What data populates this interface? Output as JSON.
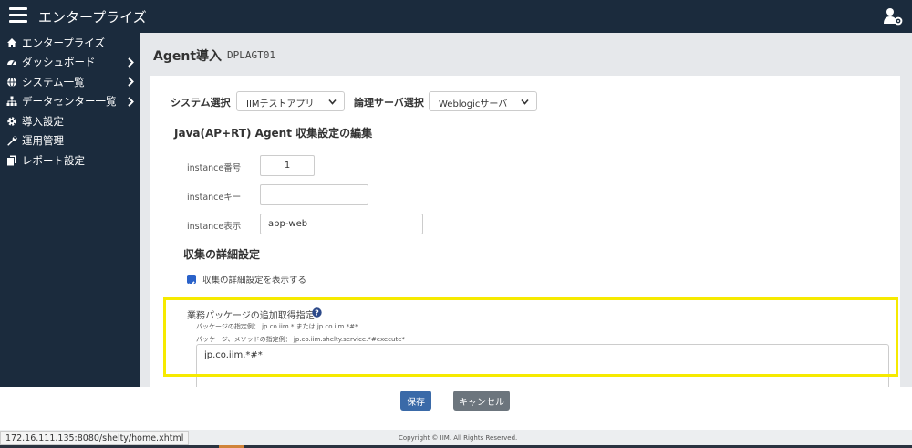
{
  "header": {
    "title": "エンタープライズ"
  },
  "sidebar": {
    "items": [
      {
        "label": "エンタープライズ",
        "icon": "home-icon",
        "has_children": false
      },
      {
        "label": "ダッシュボード",
        "icon": "dashboard-icon",
        "has_children": true
      },
      {
        "label": "システム一覧",
        "icon": "globe-icon",
        "has_children": true
      },
      {
        "label": "データセンター一覧",
        "icon": "sitemap-icon",
        "has_children": true
      },
      {
        "label": "導入設定",
        "icon": "gear-icon",
        "has_children": false
      },
      {
        "label": "運用管理",
        "icon": "wrench-icon",
        "has_children": false
      },
      {
        "label": "レポート設定",
        "icon": "copy-icon",
        "has_children": false
      }
    ]
  },
  "page": {
    "title": "Agent導入",
    "code": "DPLAGT01"
  },
  "system_select": {
    "label": "システム選択",
    "value": "IIMテストアプリ"
  },
  "server_select": {
    "label": "論理サーバ選択",
    "value": "Weblogicサーバ"
  },
  "edit_section": {
    "title": "Java(AP+RT) Agent 収集設定の編集"
  },
  "fields": {
    "instance_number": {
      "label": "instance番号",
      "value": "1"
    },
    "instance_key": {
      "label": "instanceキー",
      "value": ""
    },
    "instance_display": {
      "label": "instance表示",
      "value": "app-web"
    }
  },
  "detail_section": {
    "title": "収集の詳細設定",
    "show_detail_checkbox": {
      "label": "収集の詳細設定を表示する",
      "checked": true
    }
  },
  "package": {
    "title": "業務パッケージの追加取得指定",
    "hint1": "パッケージの指定例： jp.co.iim.* または jp.co.iim.*#*",
    "hint2": "パッケージ、メソッドの指定例： jp.co.iim.shelty.service.*#execute*",
    "value": "jp.co.iim.*#*"
  },
  "buttons": {
    "save": "保存",
    "cancel": "キャンセル"
  },
  "status": {
    "url": "172.16.111.135:8080/shelty/home.xhtml"
  },
  "footer": {
    "copyright": "Copyright © IIM. All Rights Reserved."
  },
  "colors": {
    "header_bg": "#1b2b3d",
    "save_button": "#3a6aa8",
    "cancel_button": "#6c757d",
    "highlight": "#f6ea00",
    "checkbox": "#2a62c9"
  }
}
